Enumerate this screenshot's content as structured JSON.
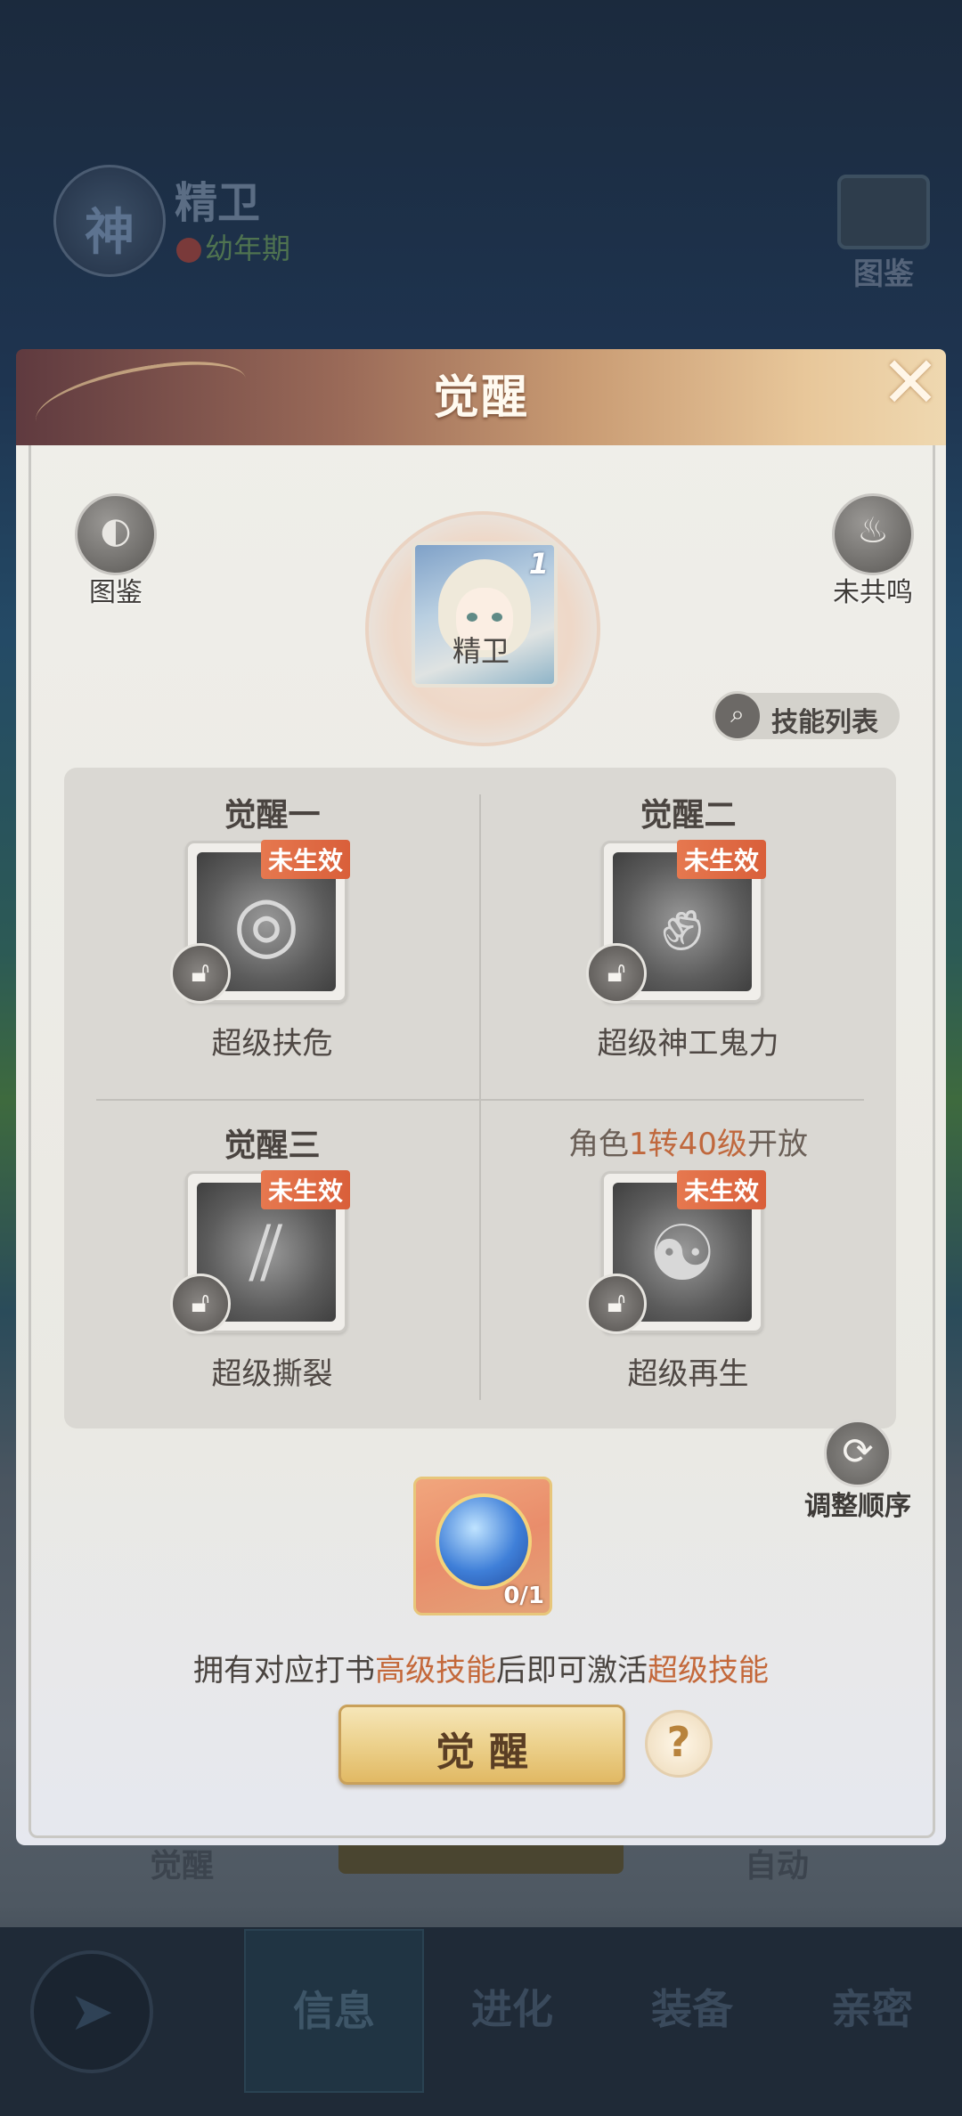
{
  "background": {
    "character_name": "精卫",
    "character_badge": "神",
    "growth_stage": "幼年期",
    "dex_label": "图鉴",
    "bottom_labels": [
      "觉醒",
      "自动"
    ],
    "nav_tabs": [
      "信息",
      "进化",
      "装备",
      "亲密"
    ],
    "active_tab": "信息"
  },
  "modal": {
    "title": "觉醒",
    "close_icon": "close-icon",
    "left_corner": {
      "label": "图鉴",
      "icon": "book-icon"
    },
    "right_corner": {
      "label": "未共鸣",
      "icon": "flame-icon"
    },
    "portrait": {
      "name": "精卫",
      "level": "1"
    },
    "skill_list_button": "技能列表",
    "awakenings": [
      {
        "title": "觉醒一",
        "status": "未生效",
        "skill": "超级扶危",
        "icon": "vortex-icon"
      },
      {
        "title": "觉醒二",
        "status": "未生效",
        "skill": "超级神工鬼力",
        "icon": "fist-icon"
      },
      {
        "title": "觉醒三",
        "status": "未生效",
        "skill": "超级撕裂",
        "icon": "claw-icon"
      },
      {
        "title_parts": [
          "角色",
          "1转40级",
          "开放"
        ],
        "status": "未生效",
        "skill": "超级再生",
        "icon": "meditate-icon"
      }
    ],
    "item": {
      "count": "0/1",
      "icon": "blue-orb-icon"
    },
    "reorder_label": "调整顺序",
    "hint_parts": [
      "拥有对应打书",
      "高级技能",
      "后即可激活",
      "超级技能"
    ],
    "awaken_button": "觉醒",
    "help_icon": "question-icon"
  },
  "colors": {
    "accent_orange": "#c4683a",
    "badge_orange": "#e6784f",
    "button_gold": "#ecd18c"
  }
}
